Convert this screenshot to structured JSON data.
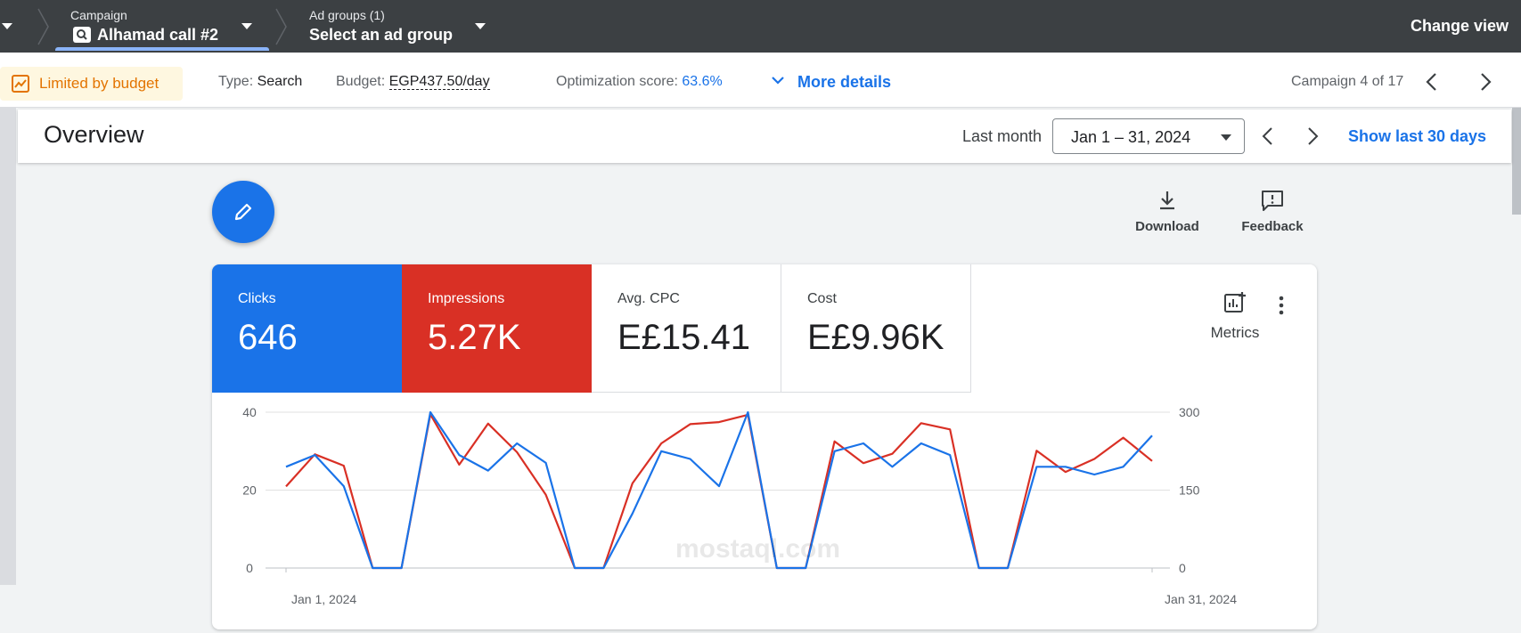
{
  "topbar": {
    "campaign_label": "Campaign",
    "campaign_value": "Alhamad call #2",
    "adgroups_label": "Ad groups (1)",
    "adgroups_value": "Select an ad group",
    "change_view": "Change view"
  },
  "infobar": {
    "budget_status": "Limited by budget",
    "type_label": "Type:",
    "type_value": "Search",
    "budget_label": "Budget:",
    "budget_value": "EGP437.50/day",
    "opt_label": "Optimization score:",
    "opt_value": "63.6%",
    "more_details": "More details",
    "campaign_count": "Campaign 4 of 17"
  },
  "overview": {
    "title": "Overview",
    "range_label": "Last month",
    "range_value": "Jan 1 – 31, 2024",
    "show_last": "Show last 30 days"
  },
  "tools": {
    "download": "Download",
    "feedback": "Feedback"
  },
  "metrics": {
    "clicks_label": "Clicks",
    "clicks_value": "646",
    "impr_label": "Impressions",
    "impr_value": "5.27K",
    "cpc_label": "Avg. CPC",
    "cpc_value": "E£15.41",
    "cost_label": "Cost",
    "cost_value": "E£9.96K",
    "metrics_button": "Metrics"
  },
  "watermark": "mostaql.com",
  "colors": {
    "clicks": "#1a73e8",
    "impressions": "#d93025",
    "topbar": "#3c4043"
  },
  "chart_data": {
    "type": "line",
    "x_start_label": "Jan 1, 2024",
    "x_end_label": "Jan 31, 2024",
    "y_left_ticks": [
      0,
      20,
      40
    ],
    "y_right_ticks": [
      0,
      150,
      300
    ],
    "ylim_left": [
      0,
      40
    ],
    "ylim_right": [
      0,
      300
    ],
    "series": [
      {
        "name": "Clicks",
        "axis": "left",
        "color": "#1a73e8",
        "values": [
          26,
          29,
          21,
          0,
          0,
          40,
          29,
          25,
          32,
          27,
          0,
          0,
          14,
          30,
          28,
          21,
          40,
          0,
          0,
          30,
          32,
          26,
          32,
          29,
          0,
          0,
          26,
          26,
          24,
          26,
          34
        ]
      },
      {
        "name": "Impressions",
        "axis": "right",
        "color": "#d93025",
        "values": [
          157,
          219,
          197,
          0,
          0,
          296,
          199,
          278,
          223,
          141,
          0,
          0,
          163,
          240,
          277,
          281,
          295,
          0,
          0,
          244,
          202,
          220,
          279,
          267,
          0,
          0,
          226,
          185,
          210,
          251,
          206
        ]
      }
    ]
  }
}
